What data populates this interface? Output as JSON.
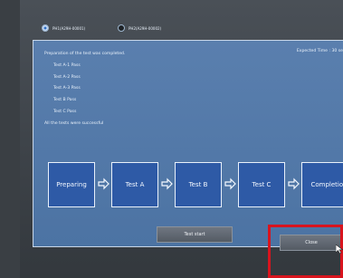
{
  "tabs": [
    {
      "label": "PH1(A29H-00001)",
      "selected": true
    },
    {
      "label": "PH2(A29H-00002)",
      "selected": false
    }
  ],
  "messages": {
    "header": "Preparation of the test was completed.",
    "expected_time": "Expected Time : 30 se",
    "lines": [
      "Test A-1 Pass",
      "Test A-2 Pass",
      "Test A-3 Pass",
      "Test B Pass",
      "Test C Pass"
    ],
    "footer": "All the tests were successful"
  },
  "flow": [
    "Preparing",
    "Test A",
    "Test B",
    "Test C",
    "Completion"
  ],
  "buttons": {
    "test_start": "Test start",
    "close": "Close"
  },
  "colors": {
    "panel": "#5a7fae",
    "step": "#2e5aa6",
    "highlight": "#d8141e"
  }
}
